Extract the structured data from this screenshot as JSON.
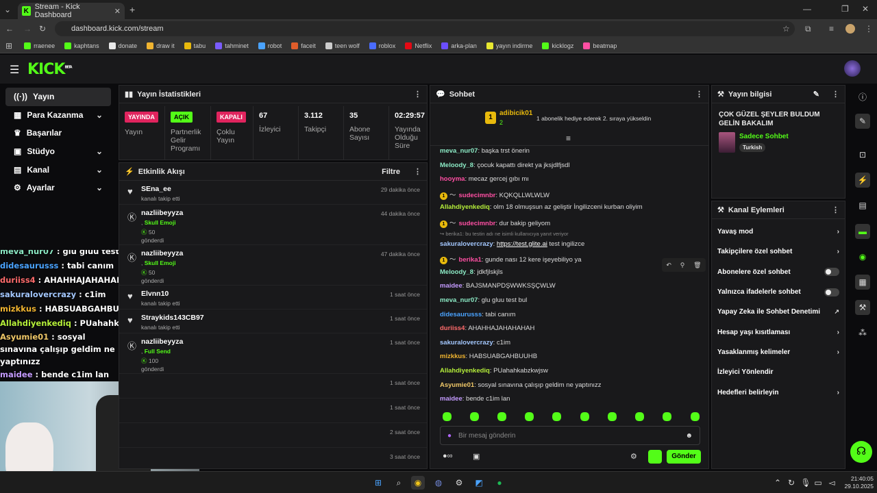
{
  "browser": {
    "tab_title": "Stream - Kick Dashboard",
    "url": "dashboard.kick.com/stream",
    "bookmarks": [
      "rraenee",
      "kaphtans",
      "donate",
      "draw it",
      "tabu",
      "tahminet",
      "robot",
      "faceit",
      "teen wolf",
      "roblox",
      "Netflix",
      "arka-plan",
      "yayın indirme",
      "kicklogz",
      "beatmap"
    ]
  },
  "kick": {
    "logo": "KICK",
    "beta": "BETA"
  },
  "nav": {
    "items": [
      "Yayın",
      "Para Kazanma",
      "Başarılar",
      "Stüdyo",
      "Kanal",
      "Ayarlar"
    ]
  },
  "overlay_chat": [
    {
      "user": "meva_nur07",
      "text": "glu gluu test bul",
      "color": "#8be9c4"
    },
    {
      "user": "didesaurusss",
      "text": "tabi canım",
      "color": "#4aa3ff"
    },
    {
      "user": "duriiss4",
      "text": "AHAHHAJAHAHAHAH",
      "color": "#ff6b6b"
    },
    {
      "user": "sakuralovercrazy",
      "text": "c1im",
      "color": "#a4c8ff"
    },
    {
      "user": "mizkkus",
      "text": "HABSUABGAHBUUHB",
      "color": "#f0b430"
    },
    {
      "user": "Allahdiyenkediq",
      "text": "PUahahkabzkwjsw",
      "color": "#b6f03a"
    },
    {
      "user": "Asyumie01",
      "text": "sosyal sınavına çalışıp geldim ne yaptınızz",
      "color": "#f0c868"
    },
    {
      "user": "maidee",
      "text": "bende c1im lan",
      "color": "#c49bff"
    }
  ],
  "stats": {
    "title": "Yayın İstatistikleri",
    "pills": [
      {
        "label": "YAYINDA",
        "sub": "Yayın",
        "color": "#e0245e"
      },
      {
        "label": "AÇIK",
        "sub": "Partnerlik Gelir Programı",
        "color": "#53fc18"
      },
      {
        "label": "KAPALI",
        "sub": "Çoklu Yayın",
        "color": "#e0245e"
      }
    ],
    "numbers": [
      {
        "value": "67",
        "label": "İzleyici"
      },
      {
        "value": "3.112",
        "label": "Takipçi"
      },
      {
        "value": "35",
        "label": "Abone Sayısı"
      },
      {
        "value": "02:29:57",
        "label": "Yayında Olduğu Süre"
      }
    ]
  },
  "events": {
    "title": "Etkinlik Akışı",
    "filter": "Filtre",
    "items": [
      {
        "name": "SEna_ee",
        "sub": "kanalı takip etti",
        "time": "29 dakika önce",
        "type": "follow"
      },
      {
        "name": "nazliibeyyza",
        "gift": "Skull Emoji",
        "amount": "50",
        "sub": "gönderdi",
        "time": "44 dakika önce",
        "type": "kick"
      },
      {
        "name": "nazliibeyyza",
        "gift": "Skull Emoji",
        "amount": "50",
        "sub": "gönderdi",
        "time": "47 dakika önce",
        "type": "kick"
      },
      {
        "name": "Elvnn10",
        "sub": "kanalı takip etti",
        "time": "1 saat önce",
        "type": "follow"
      },
      {
        "name": "Straykids143CB97",
        "sub": "kanalı takip etti",
        "time": "1 saat önce",
        "type": "follow"
      },
      {
        "name": "nazliibeyyza",
        "gift": "Full Send",
        "amount": "100",
        "sub": "gönderdi",
        "time": "1 saat önce",
        "type": "kick"
      },
      {
        "name": "",
        "sub": "",
        "time": "1 saat önce",
        "type": "blank"
      },
      {
        "name": "",
        "sub": "",
        "time": "1 saat önce",
        "type": "blank"
      },
      {
        "name": "",
        "sub": "",
        "time": "2 saat önce",
        "type": "blank"
      },
      {
        "name": "",
        "sub": "",
        "time": "3 saat önce",
        "type": "blank"
      }
    ]
  },
  "chat": {
    "title": "Sohbet",
    "pinned_user": "adibicik01",
    "pinned_count": "2",
    "pinned_msg": "1 abonelik hediye ederek 2. sıraya yükseldin",
    "placeholder": "Bir mesaj gönderin",
    "send": "Gönder",
    "messages": [
      {
        "user": "meva_nur07",
        "text": "başka trst önerin",
        "color": "#8be9c4"
      },
      {
        "user": "Meloody_8",
        "text": "çocuk kapattı direkt ya jksjdlfjsdl",
        "color": "#8be9c4"
      },
      {
        "user": "hooyma",
        "text": "mecaz gercej gıbı mı",
        "color": "#ff4fa3"
      },
      {
        "user": "sudecimnbr",
        "text": "KQKQLLWLWLW",
        "color": "#ff4fa3",
        "badge": true
      },
      {
        "user": "Allahdiyenkediq",
        "text": "olm 18 olmuşsun az geliştir İngilizceni kurban oliyim",
        "color": "#b6f03a"
      },
      {
        "user": "sudecimnbr",
        "text": "dur bakip geliyom",
        "color": "#ff4fa3",
        "badge": true
      },
      {
        "user": "sakuralovercrazy",
        "text": "test ingilizce",
        "link": "https://test.glite.ai",
        "color": "#a4c8ff",
        "reply": "berika1: bu testin adı ne isimli kullanıcıya yanıt veriyor"
      },
      {
        "user": "berika1",
        "text": "gunde nası 12 kere işeyebiliyo ya",
        "color": "#ff4fa3",
        "badge": true
      },
      {
        "user": "Meloody_8",
        "text": "jdkfjlskjls",
        "color": "#8be9c4"
      },
      {
        "user": "maidee",
        "text": "BAJSMANPDŞWWKSŞÇWLW",
        "color": "#c49bff"
      },
      {
        "user": "meva_nur07",
        "text": "glu gluu test bul",
        "color": "#8be9c4"
      },
      {
        "user": "didesaurusss",
        "text": "tabi canım",
        "color": "#4aa3ff"
      },
      {
        "user": "duriiss4",
        "text": "AHAHHAJAHAHAHAH",
        "color": "#ff6b6b"
      },
      {
        "user": "sakuralovercrazy",
        "text": "c1im",
        "color": "#a4c8ff"
      },
      {
        "user": "mizkkus",
        "text": "HABSUABGAHBUUHB",
        "color": "#f0b430"
      },
      {
        "user": "Allahdiyenkediq",
        "text": "PUahahkabzkwjsw",
        "color": "#b6f03a"
      },
      {
        "user": "Asyumie01",
        "text": "sosyal sınavına çalışıp geldim ne yaptınızz",
        "color": "#f0c868"
      },
      {
        "user": "maidee",
        "text": "bende c1im lan",
        "color": "#c49bff"
      }
    ]
  },
  "info": {
    "title": "Yayın bilgisi",
    "stream_title": "ÇOK GÜZEL ŞEYLER BULDUM GELİN BAKALIM",
    "category": "Sadece Sohbet",
    "tag": "Turkish"
  },
  "actions": {
    "title": "Kanal Eylemleri",
    "items": [
      {
        "label": "Yavaş mod",
        "kind": "arrow"
      },
      {
        "label": "Takipçilere özel sohbet",
        "kind": "arrow"
      },
      {
        "label": "Abonelere özel sohbet",
        "kind": "toggle"
      },
      {
        "label": "Yalnızca ifadelerle sohbet",
        "kind": "toggle"
      },
      {
        "label": "Yapay Zeka ile Sohbet Denetimi",
        "kind": "ext"
      },
      {
        "label": "Hesap yaşı kısıtlaması",
        "kind": "arrow"
      },
      {
        "label": "Yasaklanmış kelimeler",
        "kind": "arrow"
      },
      {
        "label": "İzleyici Yönlendir",
        "kind": "none"
      },
      {
        "label": "Hedefleri belirleyin",
        "kind": "arrow"
      }
    ]
  },
  "taskbar": {
    "time": "21:40:05",
    "date": "29.10.2025"
  },
  "colors": {
    "accent": "#53fc18",
    "live": "#e0245e"
  }
}
